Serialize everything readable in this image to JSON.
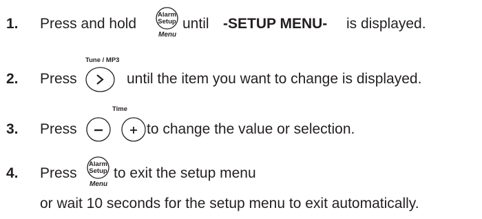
{
  "steps": [
    {
      "number": "1.",
      "text_before": "Press and hold",
      "button": {
        "line1": "Alarm",
        "line2": "Setup",
        "caption": "Menu",
        "icon": "alarm-setup-button"
      },
      "text_middle": "until",
      "text_bold": "-SETUP MENU-",
      "text_after": "is displayed."
    },
    {
      "number": "2.",
      "text_before": "Press",
      "button": {
        "caption": "Tune / MP3",
        "symbol": ">",
        "icon": "next-button"
      },
      "text_after": "until the item you want to change is displayed."
    },
    {
      "number": "3.",
      "text_before": "Press",
      "caption": "Time",
      "buttons": [
        {
          "symbol": "−",
          "icon": "minus-button"
        },
        {
          "symbol": "+",
          "icon": "plus-button"
        }
      ],
      "text_after": "to change the value or selection."
    },
    {
      "number": "4.",
      "text_before": "Press",
      "button": {
        "line1": "Alarm",
        "line2": "Setup",
        "caption": "Menu",
        "icon": "alarm-setup-button"
      },
      "text_after": "to exit the setup menu",
      "text_line2": "or wait 10 seconds for the setup menu to exit automatically."
    }
  ]
}
